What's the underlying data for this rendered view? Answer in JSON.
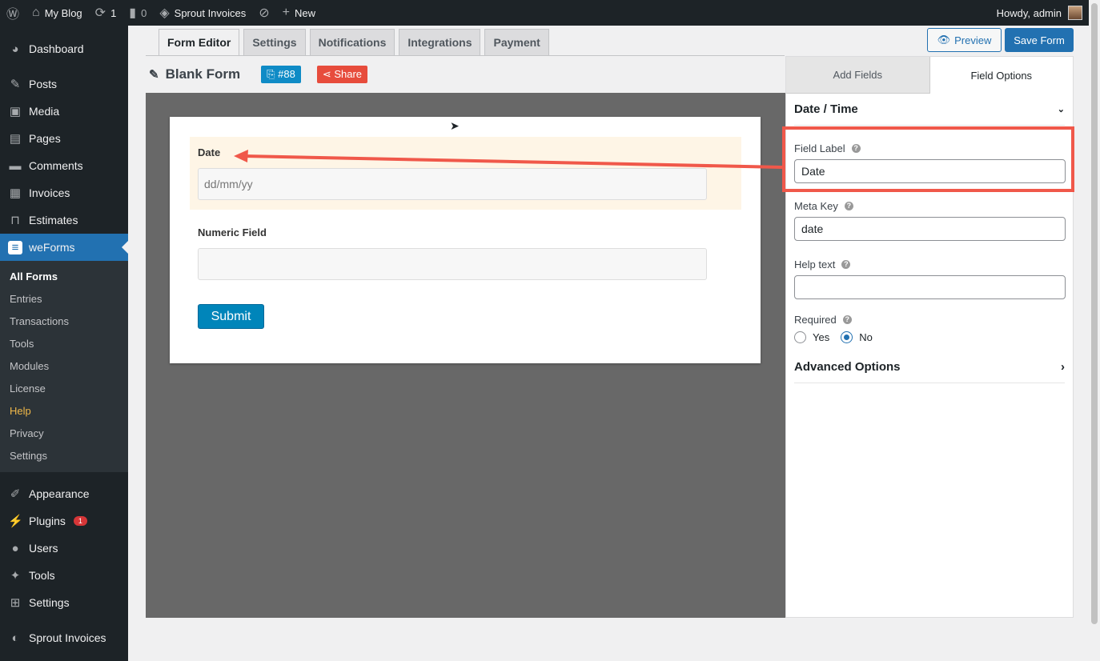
{
  "adminbar": {
    "site": "My Blog",
    "updates": "1",
    "comments": "0",
    "plugin": "Sprout Invoices",
    "new": "New",
    "howdy": "Howdy, admin"
  },
  "sidebar": {
    "items": [
      {
        "label": "Dashboard",
        "icon": "◕"
      },
      {
        "label": "Posts",
        "icon": "✎"
      },
      {
        "label": "Media",
        "icon": "▣"
      },
      {
        "label": "Pages",
        "icon": "▤"
      },
      {
        "label": "Comments",
        "icon": "▬"
      },
      {
        "label": "Invoices",
        "icon": "▦"
      },
      {
        "label": "Estimates",
        "icon": "⊓"
      },
      {
        "label": "weForms",
        "icon": "≡"
      }
    ],
    "submenu": [
      "All Forms",
      "Entries",
      "Transactions",
      "Tools",
      "Modules",
      "License",
      "Help",
      "Privacy",
      "Settings"
    ],
    "bottom": [
      {
        "label": "Appearance",
        "icon": "✐"
      },
      {
        "label": "Plugins",
        "icon": "⚡",
        "badge": "1"
      },
      {
        "label": "Users",
        "icon": "●"
      },
      {
        "label": "Tools",
        "icon": "✦"
      },
      {
        "label": "Settings",
        "icon": "⊞"
      },
      {
        "label": "Sprout Invoices",
        "icon": "◐"
      }
    ]
  },
  "tabs": [
    "Form Editor",
    "Settings",
    "Notifications",
    "Integrations",
    "Payment"
  ],
  "actions": {
    "preview": "Preview",
    "save": "Save Form"
  },
  "form": {
    "title": "Blank Form",
    "id": "#88",
    "share": "Share",
    "fields": [
      {
        "label": "Date",
        "placeholder": "dd/mm/yy"
      },
      {
        "label": "Numeric Field",
        "placeholder": ""
      }
    ],
    "submit": "Submit"
  },
  "panel": {
    "tabs": [
      "Add Fields",
      "Field Options"
    ],
    "section": "Date / Time",
    "field_label": {
      "label": "Field Label",
      "value": "Date"
    },
    "meta_key": {
      "label": "Meta Key",
      "value": "date"
    },
    "help_text": {
      "label": "Help text",
      "value": ""
    },
    "required": {
      "label": "Required",
      "yes": "Yes",
      "no": "No",
      "selected": "No"
    },
    "advanced": "Advanced Options"
  },
  "colors": {
    "accent": "#2271b1",
    "annotation": "#f0584a",
    "share": "#e74c3c",
    "id_badge": "#0f8bc6"
  }
}
